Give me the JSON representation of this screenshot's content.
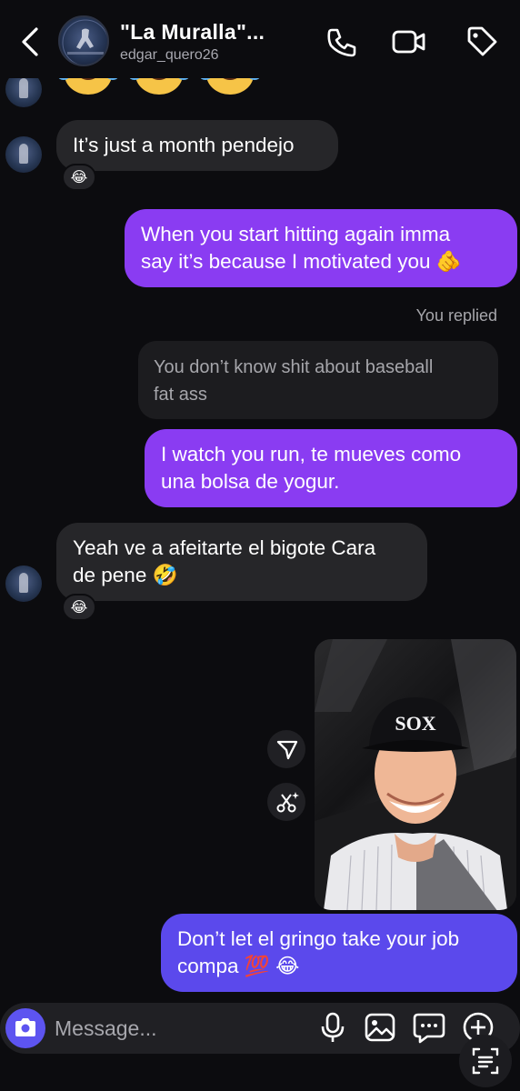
{
  "header": {
    "name": "\"La Muralla\"...",
    "username": "edgar_quero26"
  },
  "thread": {
    "msg_in_1": "It’s just a month pendejo",
    "reaction_1": "😂",
    "msg_out_1_lines": [
      "When you start hitting again imma",
      "say it’s because I motivated you 🫵"
    ],
    "you_replied": "You replied",
    "quoted_lines": [
      "You don’t know shit about baseball",
      "fat ass"
    ],
    "msg_out_2_lines": [
      "I watch you run, te mueves como",
      "una bolsa de yogur."
    ],
    "msg_in_2_lines": [
      "Yeah ve a afeitarte el bigote Cara",
      "de pene 🤣"
    ],
    "reaction_2": "😂",
    "photo_label": "SOX",
    "msg_out_3_lines": [
      "Don’t let el gringo take your job",
      "compa 💯 😂"
    ]
  },
  "composer": {
    "placeholder": "Message..."
  },
  "colors": {
    "background": "#0c0c0f",
    "incoming_bubble": "#262629",
    "outgoing_bubble": "#8a3cf2",
    "outgoing_bubble_last": "#5b49ec",
    "camera_button": "#5d54f0"
  },
  "icons": [
    "back-chevron-icon",
    "phone-icon",
    "video-camera-icon",
    "tag-icon",
    "send-icon",
    "magic-scissors-icon",
    "camera-icon",
    "microphone-icon",
    "gallery-icon",
    "sticker-icon",
    "plus-circle-icon",
    "scan-text-icon"
  ]
}
